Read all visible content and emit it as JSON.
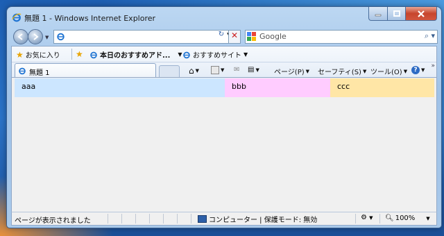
{
  "window": {
    "title": "無題 1 - Windows Internet Explorer"
  },
  "address": {
    "value": ""
  },
  "search": {
    "placeholder": "Google"
  },
  "favorites_bar": {
    "favorites_label": "お気に入り",
    "item1": "本日のおすすめアド...",
    "item2": "おすすめサイト"
  },
  "tab": {
    "label": "無題 1"
  },
  "commands": {
    "page": "ページ(P)",
    "safety": "セーフティ(S)",
    "tools": "ツール(O)"
  },
  "content": {
    "columns": [
      {
        "text": "aaa",
        "color": "#cce6ff"
      },
      {
        "text": "bbb",
        "color": "#ffccff"
      },
      {
        "text": "ccc",
        "color": "#ffe6a6"
      }
    ]
  },
  "status": {
    "text": "ページが表示されました",
    "zone": "コンピューター | 保護モード: 無効",
    "zoom": "100%"
  },
  "icons": [
    "ie-icon",
    "back-icon",
    "forward-icon",
    "refresh-icon",
    "stop-icon",
    "google-icon",
    "search-icon",
    "star-icon",
    "home-icon",
    "rss-icon",
    "mail-icon",
    "print-icon",
    "help-icon",
    "computer-icon",
    "zoom-icon"
  ]
}
